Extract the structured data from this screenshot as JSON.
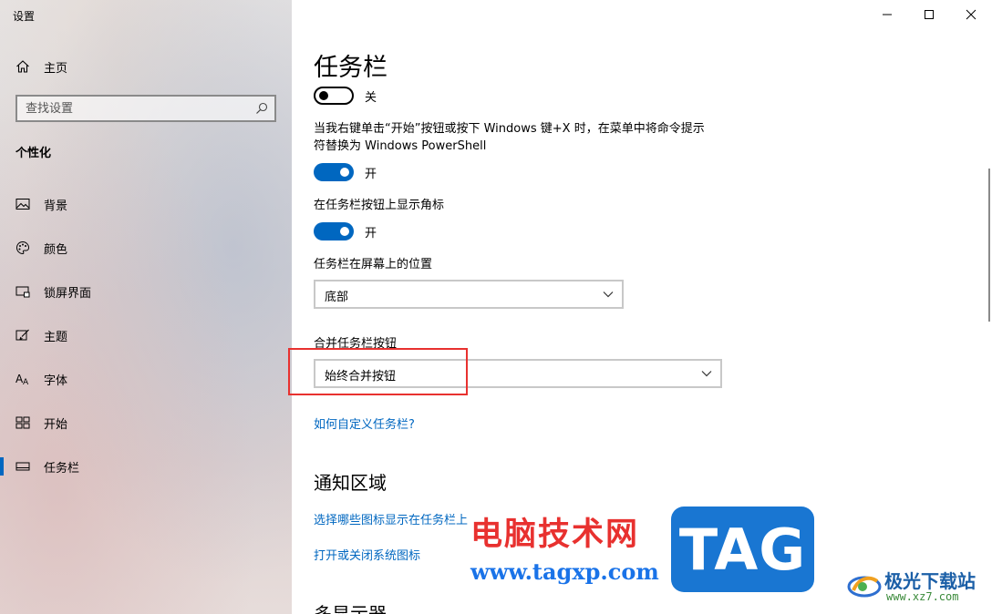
{
  "window": {
    "title": "设置",
    "controls": [
      "minimize-icon",
      "maximize-icon",
      "close-icon"
    ]
  },
  "sidebar": {
    "home_label": "主页",
    "search_placeholder": "查找设置",
    "section": "个性化",
    "items": [
      {
        "label": "背景",
        "icon": "picture-icon"
      },
      {
        "label": "颜色",
        "icon": "palette-icon"
      },
      {
        "label": "锁屏界面",
        "icon": "lock-screen-icon"
      },
      {
        "label": "主题",
        "icon": "theme-brush-icon"
      },
      {
        "label": "字体",
        "icon": "font-icon"
      },
      {
        "label": "开始",
        "icon": "start-grid-icon"
      },
      {
        "label": "任务栏",
        "icon": "taskbar-icon",
        "active": true
      }
    ]
  },
  "main": {
    "title": "任务栏",
    "toggle1_state": "关",
    "powershell_desc": "当我右键单击“开始”按钮或按下 Windows 键+X 时，在菜单中将命令提示符替换为 Windows PowerShell",
    "toggle2_state": "开",
    "badges_label": "在任务栏按钮上显示角标",
    "toggle3_state": "开",
    "position_label": "任务栏在屏幕上的位置",
    "position_value": "底部",
    "combine_label": "合并任务栏按钮",
    "combine_value": "始终合并按钮",
    "customize_link": "如何自定义任务栏?",
    "notification_title": "通知区域",
    "notif_link1": "选择哪些图标显示在任务栏上",
    "notif_link2": "打开或关闭系统图标",
    "multi_display_title": "多显示器"
  },
  "watermark": {
    "cn": "电脑技术网",
    "url": "www.tagxp.com",
    "tag": "TAG",
    "xz_name": "极光下载站",
    "xz_url": "www.xz7.com"
  },
  "colors": {
    "accent": "#0067c0",
    "highlight": "#e8312f"
  }
}
